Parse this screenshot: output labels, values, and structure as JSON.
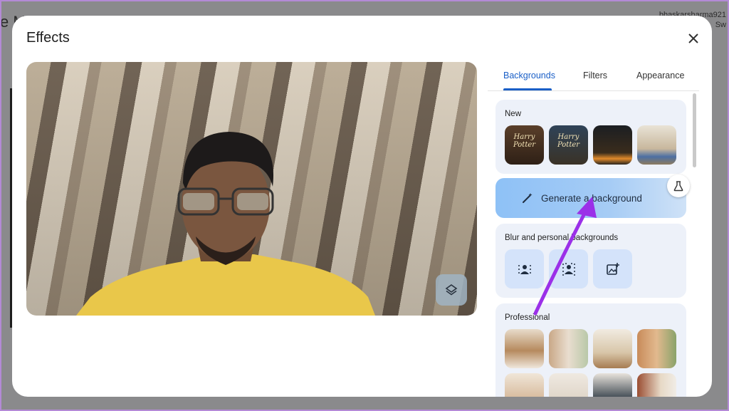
{
  "background_window": {
    "title_fragment": "e M",
    "user_text_line1": "bhaskarsharma921",
    "user_text_line2": "Sw"
  },
  "dialog": {
    "title": "Effects",
    "close_icon": "close-icon"
  },
  "tabs": [
    {
      "label": "Backgrounds",
      "active": true
    },
    {
      "label": "Filters",
      "active": false
    },
    {
      "label": "Appearance",
      "active": false
    }
  ],
  "sections": {
    "new": {
      "label": "New",
      "thumbnails": [
        {
          "text": "Harry Potter"
        },
        {
          "text": "Harry Potter"
        },
        {
          "text": ""
        },
        {
          "text": ""
        }
      ]
    },
    "generate": {
      "label": "Generate a background",
      "icon": "magic-wand-icon",
      "labs_icon": "flask-icon"
    },
    "blur": {
      "label": "Blur and personal backgrounds",
      "tiles": [
        {
          "icon": "slight-blur-icon"
        },
        {
          "icon": "full-blur-icon"
        },
        {
          "icon": "add-image-icon"
        }
      ]
    },
    "professional": {
      "label": "Professional"
    }
  },
  "colors": {
    "accent": "#1a5fc7",
    "annotation_arrow": "#9b30e8"
  }
}
